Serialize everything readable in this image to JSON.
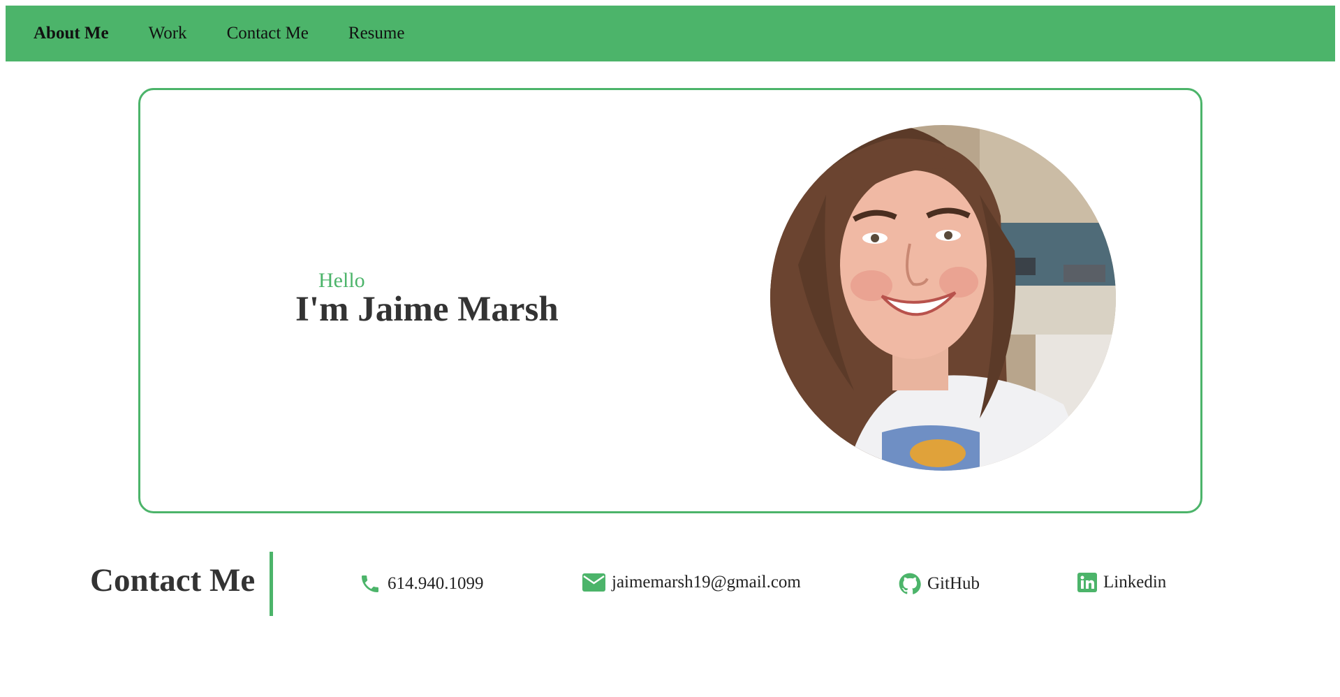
{
  "nav": {
    "items": [
      {
        "label": "About Me",
        "active": true
      },
      {
        "label": "Work",
        "active": false
      },
      {
        "label": "Contact Me",
        "active": false
      },
      {
        "label": "Resume",
        "active": false
      }
    ]
  },
  "hero": {
    "greeting": "Hello",
    "name": "I'm Jaime Marsh"
  },
  "contact": {
    "title": "Contact Me",
    "phone": "614.940.1099",
    "email": "jaimemarsh19@gmail.com",
    "github": "GitHub",
    "linkedin": "Linkedin"
  },
  "icons": {
    "phone": "phone-icon",
    "email": "envelope-icon",
    "github": "github-icon",
    "linkedin": "linkedin-icon"
  },
  "colors": {
    "accent": "#4cb46a",
    "text": "#333333"
  }
}
